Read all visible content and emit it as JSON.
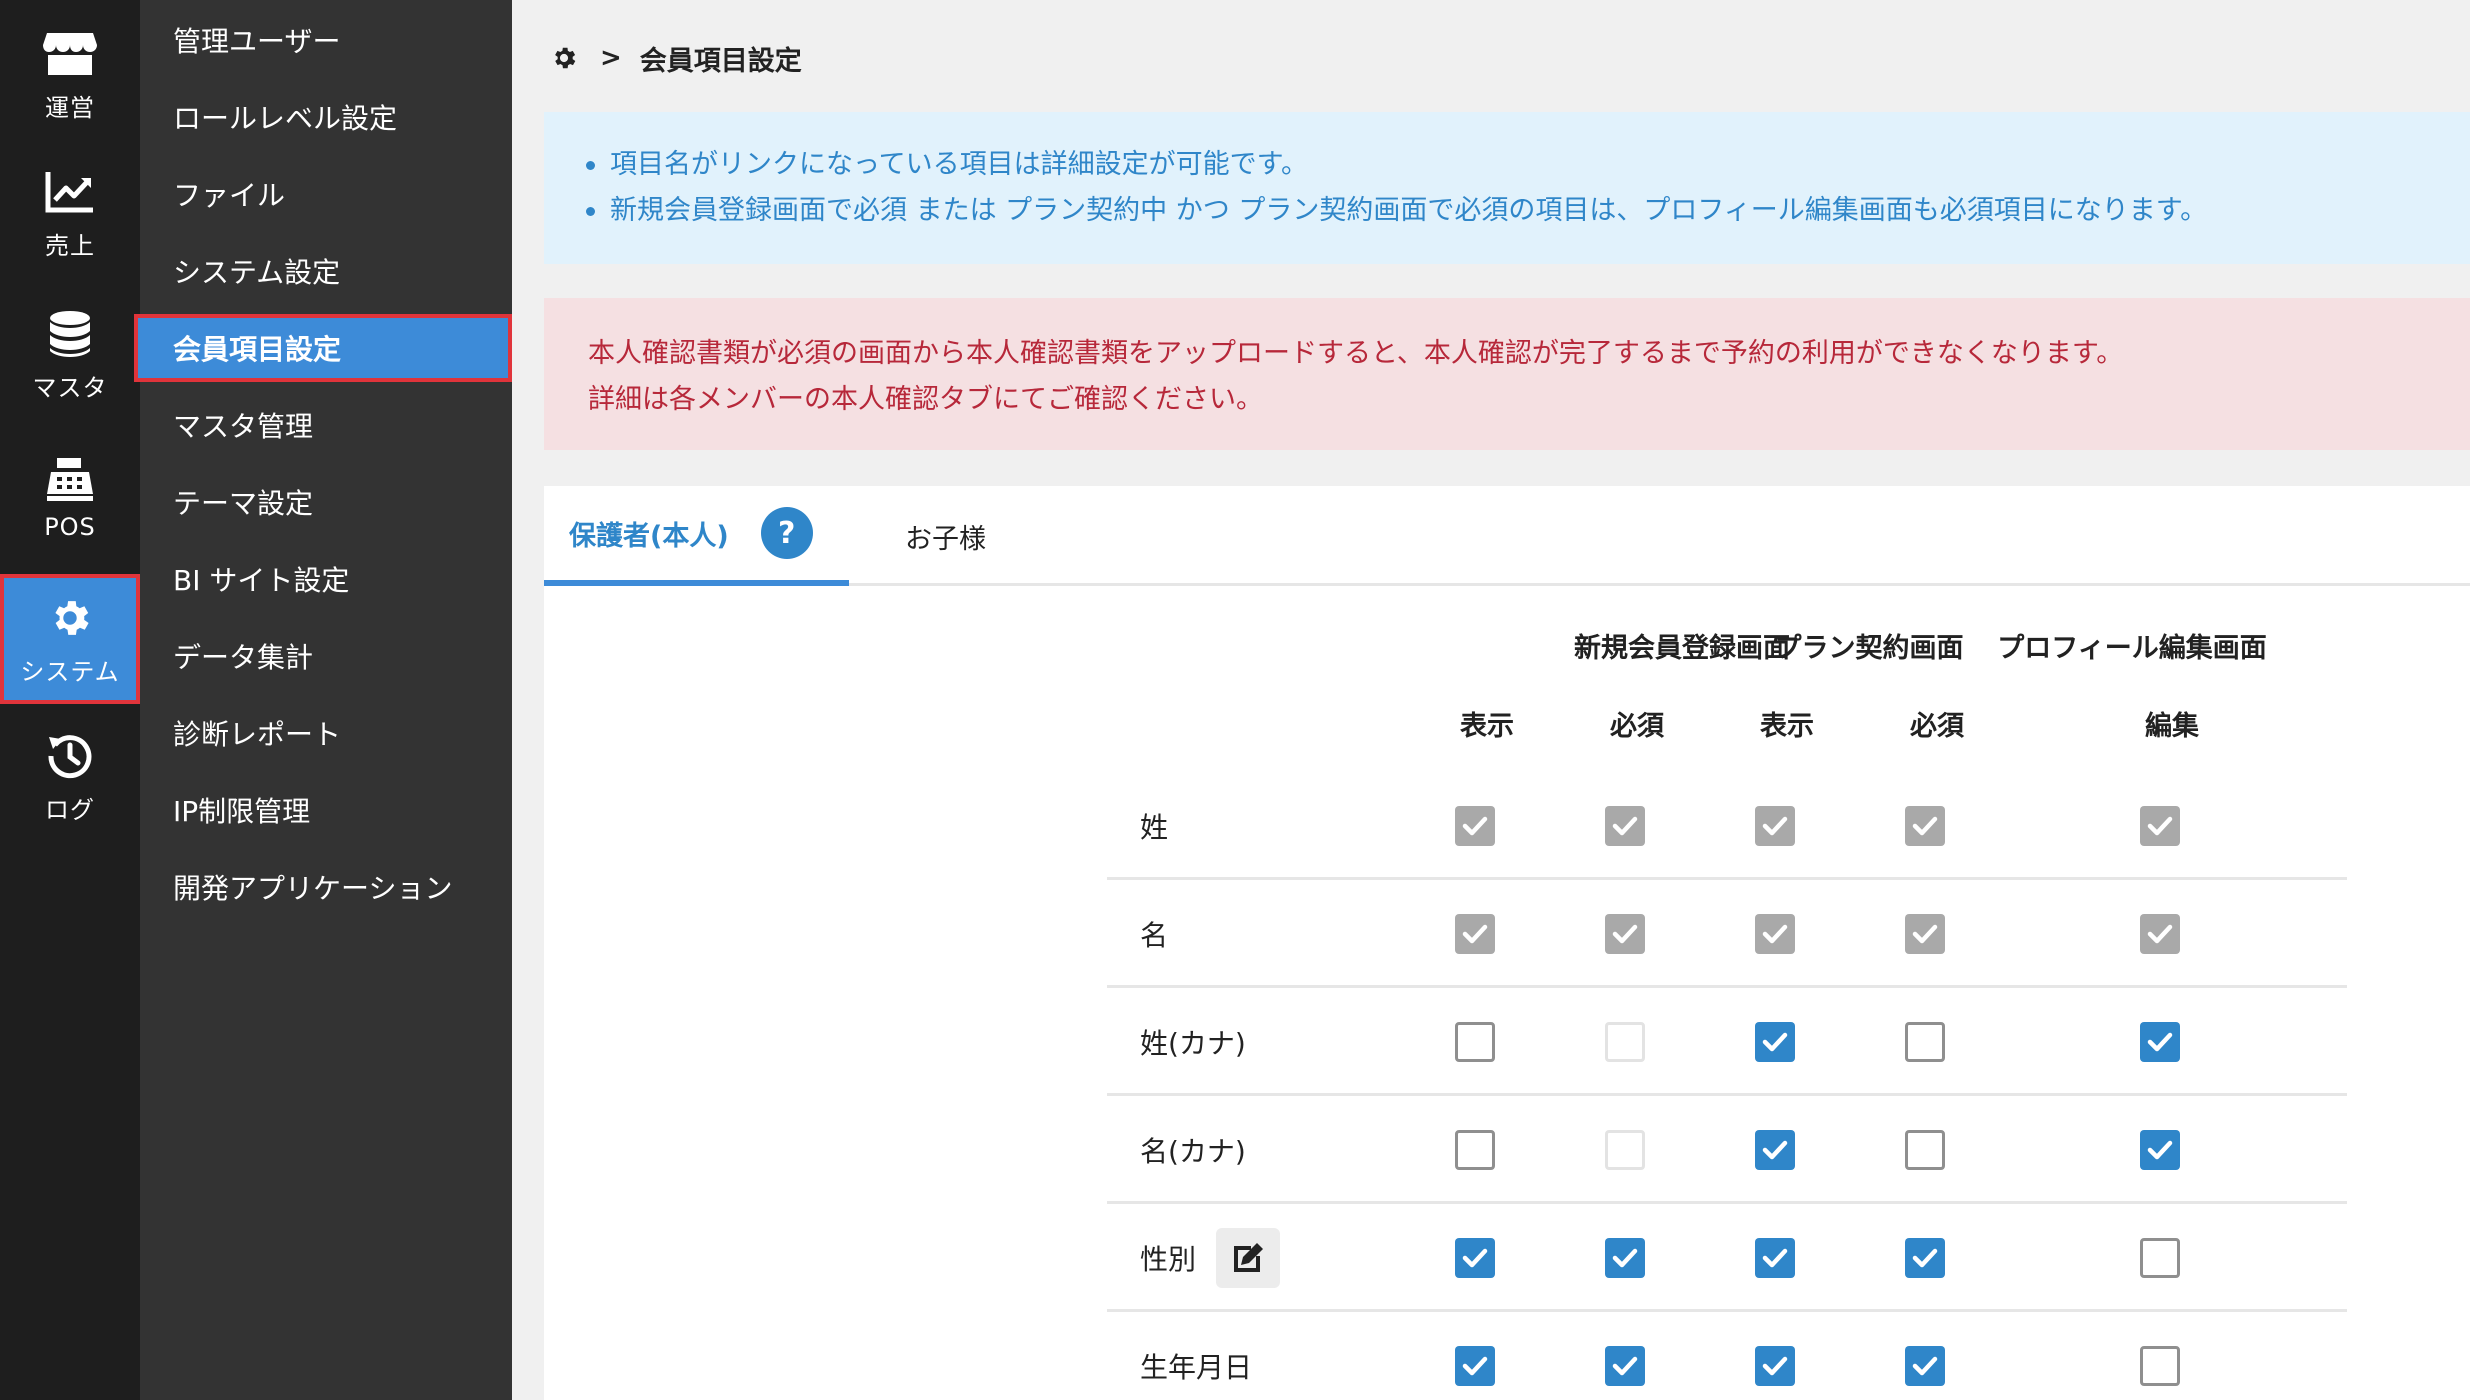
{
  "rail": [
    {
      "icon": "store-icon",
      "label": "運営",
      "active": false
    },
    {
      "icon": "chart-line-icon",
      "label": "売上",
      "active": false
    },
    {
      "icon": "database-icon",
      "label": "マスタ",
      "active": false
    },
    {
      "icon": "cash-register-icon",
      "label": "POS",
      "active": false
    },
    {
      "icon": "gear-icon",
      "label": "システム",
      "active": true
    },
    {
      "icon": "history-icon",
      "label": "ログ",
      "active": false
    }
  ],
  "submenu": [
    {
      "label": "管理ユーザー",
      "active": false
    },
    {
      "label": "ロールレベル設定",
      "active": false
    },
    {
      "label": "ファイル",
      "active": false
    },
    {
      "label": "システム設定",
      "active": false
    },
    {
      "label": "会員項目設定",
      "active": true
    },
    {
      "label": "マスタ管理",
      "active": false
    },
    {
      "label": "テーマ設定",
      "active": false
    },
    {
      "label": "BI サイト設定",
      "active": false
    },
    {
      "label": "データ集計",
      "active": false
    },
    {
      "label": "診断レポート",
      "active": false
    },
    {
      "label": "IP制限管理",
      "active": false
    },
    {
      "label": "開発アプリケーション",
      "active": false
    }
  ],
  "breadcrumb": {
    "icon": "gear-icon",
    "separator": ">",
    "current": "会員項目設定"
  },
  "info": [
    "項目名がリンクになっている項目は詳細設定が可能です。",
    "新規会員登録画面で必須 または プラン契約中 かつ プラン契約画面で必須の項目は、プロフィール編集画面も必須項目になります。"
  ],
  "alert": [
    "本人確認書類が必須の画面から本人確認書類をアップロードすると、本人確認が完了するまで予約の利用ができなくなります。",
    "詳細は各メンバーの本人確認タブにてご確認ください。"
  ],
  "tabs": [
    {
      "label": "保護者(本人)",
      "active": true,
      "help": "?"
    },
    {
      "label": "お子様",
      "active": false
    }
  ],
  "table": {
    "groups": [
      "新規会員登録画面",
      "プラン契約画面",
      "プロフィール編集画面"
    ],
    "subheaders": [
      "表示",
      "必須",
      "表示",
      "必須",
      "編集"
    ],
    "rows": [
      {
        "label": "姓",
        "edit": false,
        "cells": [
          "disabled-checked",
          "disabled-checked",
          "disabled-checked",
          "disabled-checked",
          "disabled-checked"
        ]
      },
      {
        "label": "名",
        "edit": false,
        "cells": [
          "disabled-checked",
          "disabled-checked",
          "disabled-checked",
          "disabled-checked",
          "disabled-checked"
        ]
      },
      {
        "label": "姓(カナ)",
        "edit": false,
        "cells": [
          "unchecked",
          "disabled",
          "checked",
          "unchecked",
          "checked"
        ]
      },
      {
        "label": "名(カナ)",
        "edit": false,
        "cells": [
          "unchecked",
          "disabled",
          "checked",
          "unchecked",
          "checked"
        ]
      },
      {
        "label": "性別",
        "edit": true,
        "cells": [
          "checked",
          "checked",
          "checked",
          "checked",
          "unchecked"
        ]
      },
      {
        "label": "生年月日",
        "edit": false,
        "cells": [
          "checked",
          "checked",
          "checked",
          "checked",
          "unchecked"
        ]
      }
    ]
  },
  "colors": {
    "accent": "#3d8bd8",
    "highlight_outline": "#e0343b",
    "rail_bg": "#1e1e1e",
    "submenu_bg": "#333333",
    "info_text": "#2f86c9",
    "alert_text": "#b7283a"
  }
}
